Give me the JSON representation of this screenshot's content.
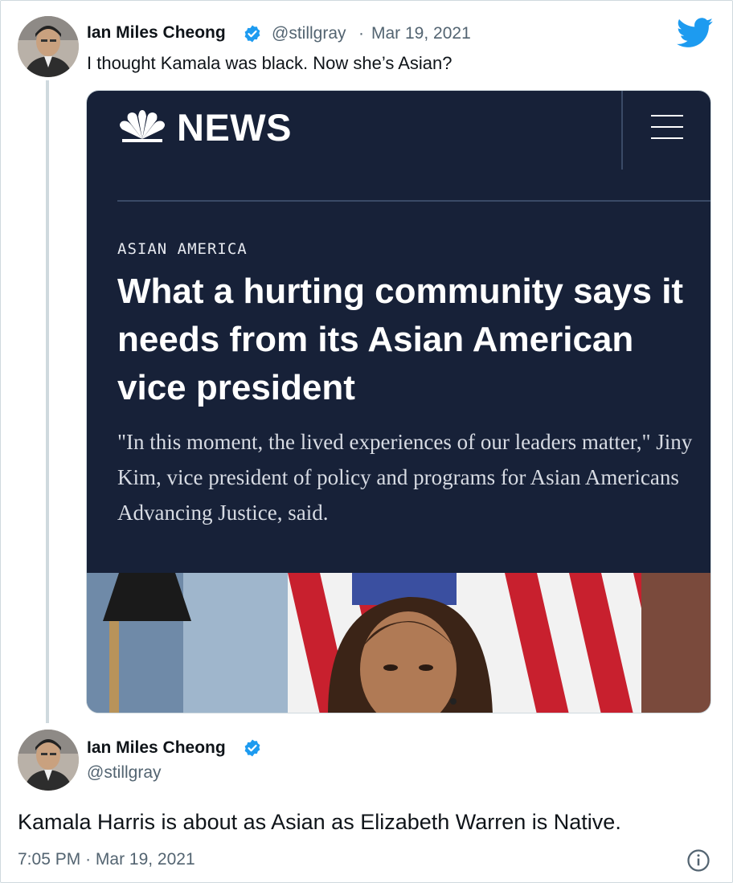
{
  "quoted_tweet": {
    "author_name": "Ian Miles Cheong",
    "author_handle": "@stillgray",
    "separator": "·",
    "date": "Mar 19, 2021",
    "text": "I thought Kamala was black. Now she’s Asian?",
    "brand_icon": "twitter-bird-icon",
    "card": {
      "site_name": "NEWS",
      "kicker": "ASIAN AMERICA",
      "headline": "What a hurting community says it needs from its Asian American vice president",
      "dek": "\"In this moment, the lived experiences of our leaders matter,\" Jiny Kim, vice president of policy and programs for Asian Americans Advancing Justice, said.",
      "logo_icon": "nbc-peacock-icon",
      "menu_icon": "hamburger-menu-icon",
      "image_alt": "kamala-harris-photo"
    }
  },
  "main_tweet": {
    "author_name": "Ian Miles Cheong",
    "author_handle": "@stillgray",
    "text": "Kamala Harris is about as Asian as Elizabeth Warren is Native.",
    "time": "7:05 PM",
    "separator": "·",
    "date": "Mar 19, 2021",
    "info_icon": "info-icon"
  },
  "colors": {
    "twitter_blue": "#1d9bf0",
    "text_primary": "#0f1419",
    "text_secondary": "#536471",
    "card_background": "#172138"
  }
}
